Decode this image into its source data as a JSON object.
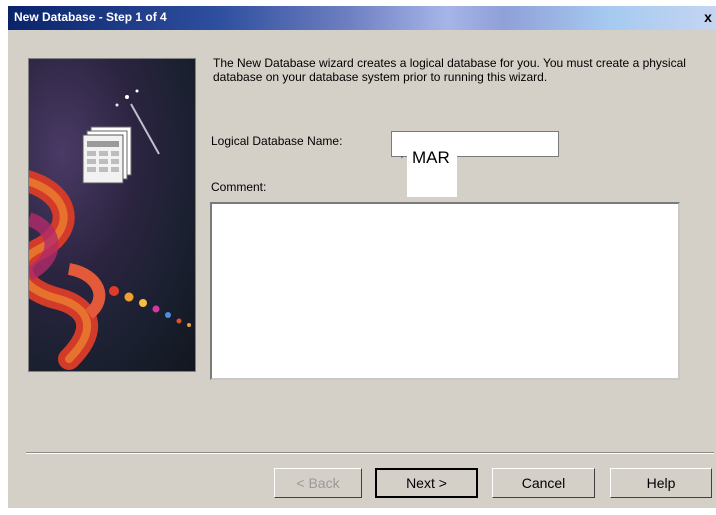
{
  "window": {
    "title": "New Database - Step 1 of 4",
    "close_glyph": "x"
  },
  "intro_text": "The New Database wizard creates a logical database for you.  You must create a physical database on your database system prior to running this wizard.",
  "form": {
    "name_label": "Logical Database Name:",
    "name_value": "MAR",
    "comment_label": "Comment:",
    "comment_value": ""
  },
  "buttons": {
    "back": "< Back",
    "next": "Next >",
    "cancel": "Cancel",
    "help": "Help"
  },
  "icons": {
    "wizard_art": "database-ribbon-illustration",
    "document": "document-stack-icon"
  }
}
